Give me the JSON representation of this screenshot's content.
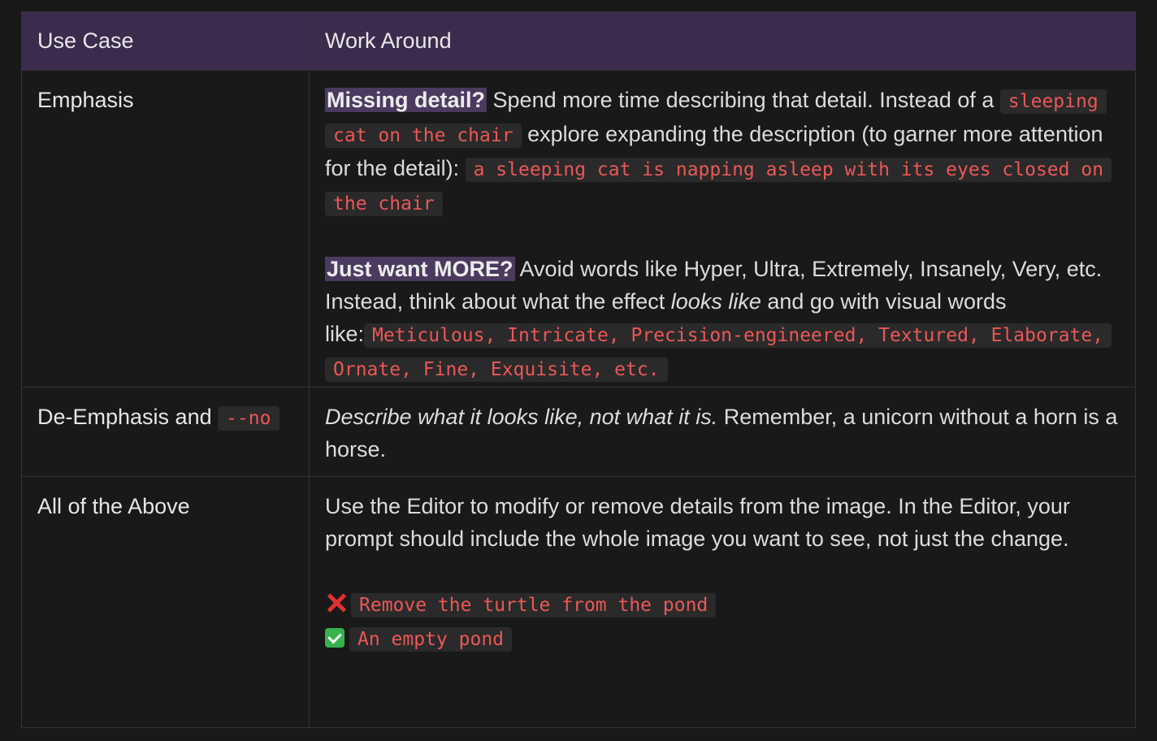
{
  "header": {
    "col1": "Use Case",
    "col2": "Work Around"
  },
  "rows": [
    {
      "use_case": "Emphasis",
      "p1": {
        "highlight": "Missing detail?",
        "t1": " Spend more time describing that detail.  Instead of  a ",
        "code1": "sleeping cat on the chair",
        "t2": " explore expanding the description (to garner more attention for the detail): ",
        "code2": "a sleeping cat is napping asleep with its eyes closed on the chair"
      },
      "p2": {
        "highlight": "Just want MORE?",
        "t1": " Avoid words like Hyper, Ultra, Extremely, Insanely, Very, etc. Instead, think about what the effect ",
        "italic": "looks like",
        "t2": " and go with visual words like:",
        "code": "Meticulous, Intricate, Precision-engineered, Textured, Elaborate, Ornate, Fine, Exquisite, etc."
      }
    },
    {
      "use_case": "De-Emphasis and ",
      "use_case_code": "--no",
      "italic": "Describe what it looks like, not what it is.",
      "text": "  Remember, a unicorn without a horn is a horse."
    },
    {
      "use_case": "All of the Above",
      "text": "Use the Editor to modify or remove details from the image. In the Editor, your prompt should include the whole image you want to see, not just the change.",
      "bad_example": "Remove the turtle from the pond",
      "good_example": "An empty pond"
    }
  ],
  "icons": {
    "bad": "cross-mark-icon",
    "good": "check-mark-icon"
  },
  "colors": {
    "header_bg": "#3b2c4e",
    "code_text": "#eb5757",
    "code_bg": "#2a2a2a",
    "highlight_bg": "#4a3a60"
  }
}
